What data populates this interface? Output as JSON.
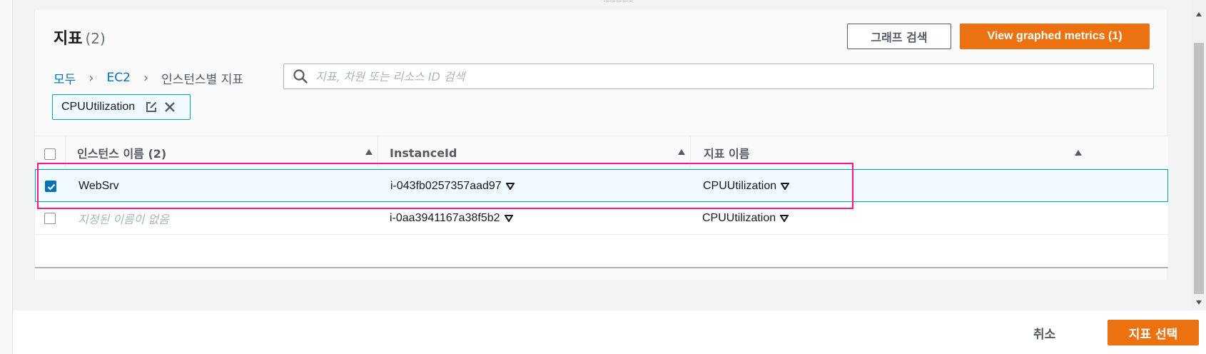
{
  "panel": {
    "title": "지표",
    "count": "(2)",
    "search_graph_button": "그래프 검색",
    "view_graphed_button": "View graphed metrics (1)"
  },
  "breadcrumb": {
    "items": [
      "모두",
      "EC2"
    ],
    "current": "인스턴스별 지표"
  },
  "search": {
    "placeholder": "지표, 차원 또는 리소스 ID 검색"
  },
  "token": {
    "label": "CPUUtilization"
  },
  "table": {
    "columns": [
      "인스턴스 이름 (2)",
      "InstanceId",
      "지표 이름"
    ],
    "rows": [
      {
        "name": "WebSrv",
        "instance_id": "i-043fb0257357aad97",
        "metric": "CPUUtilization",
        "checked": true
      },
      {
        "name": "지정된 이름이 없음",
        "instance_id": "i-0aa3941167a38f5b2",
        "metric": "CPUUtilization",
        "checked": false
      }
    ]
  },
  "footer": {
    "cancel": "취소",
    "select": "지표 선택"
  },
  "colors": {
    "primary": "#ec7211",
    "link": "#0073bb",
    "highlight": "#ff1493",
    "selected_row_border": "#00a1c9"
  }
}
